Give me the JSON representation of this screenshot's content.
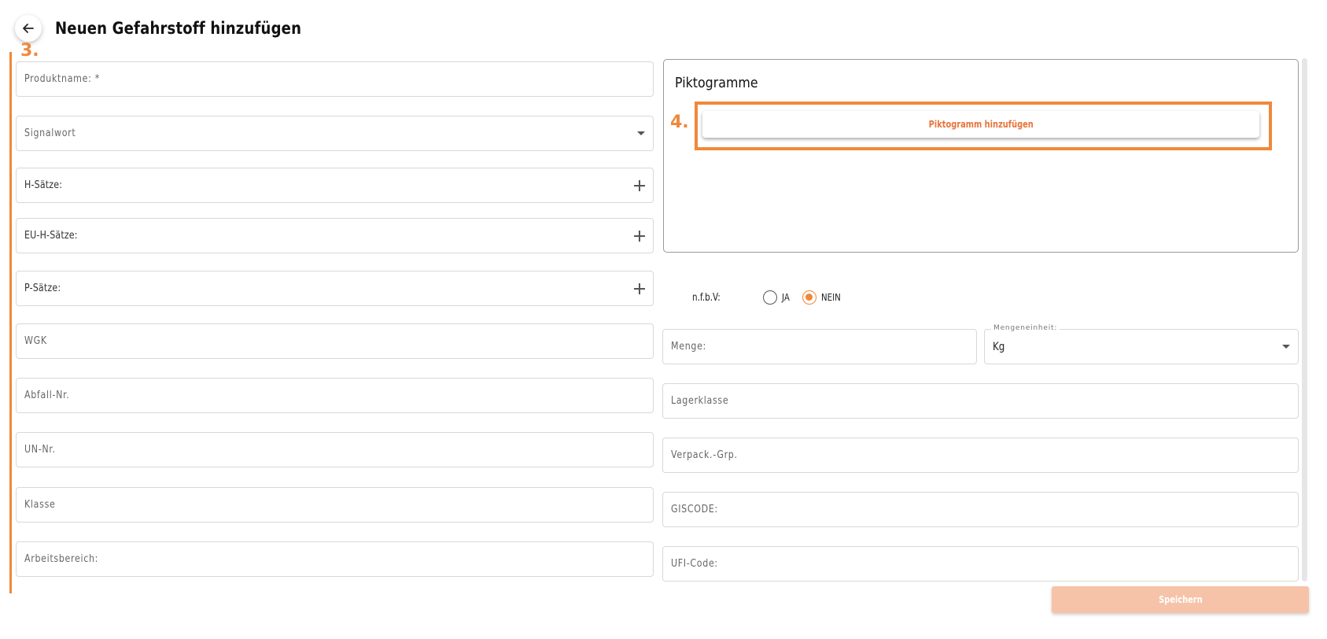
{
  "header": {
    "title": "Neuen Gefahrstoff hinzufügen",
    "back_icon": "arrow-left-icon"
  },
  "steps": {
    "left": "3.",
    "right": "4."
  },
  "left_fields": [
    {
      "label": "Produktname: *",
      "type": "text"
    },
    {
      "label": "Signalwort",
      "type": "select"
    },
    {
      "label": "H-Sätze:",
      "type": "add"
    },
    {
      "label": "EU-H-Sätze:",
      "type": "add"
    },
    {
      "label": "P-Sätze:",
      "type": "add"
    },
    {
      "label": "WGK",
      "type": "text"
    },
    {
      "label": "Abfall-Nr.",
      "type": "text"
    },
    {
      "label": "UN-Nr.",
      "type": "text"
    },
    {
      "label": "Klasse",
      "type": "text"
    },
    {
      "label": "Arbeitsbereich:",
      "type": "text"
    }
  ],
  "pictograms": {
    "title": "Piktogramme",
    "add_button": "Piktogramm hinzufügen"
  },
  "nfbv": {
    "label": "n.f.b.V:",
    "options": [
      "JA",
      "NEIN"
    ],
    "selected": "NEIN"
  },
  "right_fields": {
    "menge": "Menge:",
    "mengeneinheit_label": "Mengeneinheit:",
    "mengeneinheit_value": "Kg",
    "lagerklasse": "Lagerklasse",
    "verpack": "Verpack.-Grp.",
    "giscode": "GISCODE:",
    "ufi": "UFI-Code:"
  },
  "save_button": "Speichern",
  "colors": {
    "accent": "#f0883a",
    "save_disabled": "#f6c3a8"
  }
}
